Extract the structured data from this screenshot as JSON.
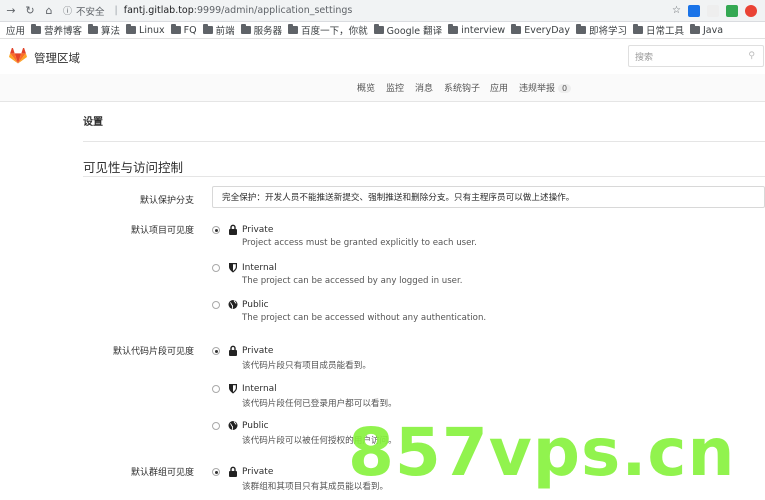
{
  "browser": {
    "insecure_label": "不安全",
    "host": "fantj.gitlab.top",
    "path": ":9999/admin/application_settings",
    "bookmarks": [
      "应用",
      "营养博客",
      "算法",
      "Linux",
      "FQ",
      "前端",
      "服务器",
      "百度一下，你就",
      "Google 翻译",
      "interview",
      "EveryDay",
      "即将学习",
      "日常工具",
      "Java"
    ]
  },
  "header": {
    "title": "管理区域",
    "search_placeholder": "搜索"
  },
  "subnav": {
    "items": [
      "概览",
      "监控",
      "消息",
      "系统钩子",
      "应用",
      "违规举报"
    ],
    "abuse_count": "0"
  },
  "page": {
    "title": "设置",
    "section_title": "可见性与访问控制",
    "protect_label": "默认保护分支",
    "protect_value": "完全保护：开发人员不能推送新提交、强制推送和删除分支。只有主程序员可以做上述操作。",
    "project_label": "默认项目可见度",
    "snippet_label": "默认代码片段可见度",
    "group_label": "默认群组可见度"
  },
  "project_options": [
    {
      "name": "Private",
      "desc": "Project access must be granted explicitly to each user.",
      "selected": true,
      "icon": "lock-icon"
    },
    {
      "name": "Internal",
      "desc": "The project can be accessed by any logged in user.",
      "selected": false,
      "icon": "shield-icon"
    },
    {
      "name": "Public",
      "desc": "The project can be accessed without any authentication.",
      "selected": false,
      "icon": "globe-icon"
    }
  ],
  "snippet_options": [
    {
      "name": "Private",
      "desc": "该代码片段只有项目成员能看到。",
      "selected": true,
      "icon": "lock-icon"
    },
    {
      "name": "Internal",
      "desc": "该代码片段任何已登录用户都可以看到。",
      "selected": false,
      "icon": "shield-icon"
    },
    {
      "name": "Public",
      "desc": "该代码片段可以被任何授权的用户访问。",
      "selected": false,
      "icon": "globe-icon"
    }
  ],
  "group_options": [
    {
      "name": "Private",
      "desc": "该群组和其项目只有其成员能以看到。",
      "selected": true,
      "icon": "lock-icon"
    }
  ],
  "watermark": "857vps.cn",
  "colors": {
    "gitlab_orange": "#e24329",
    "watermark_green": "#86f23b"
  }
}
